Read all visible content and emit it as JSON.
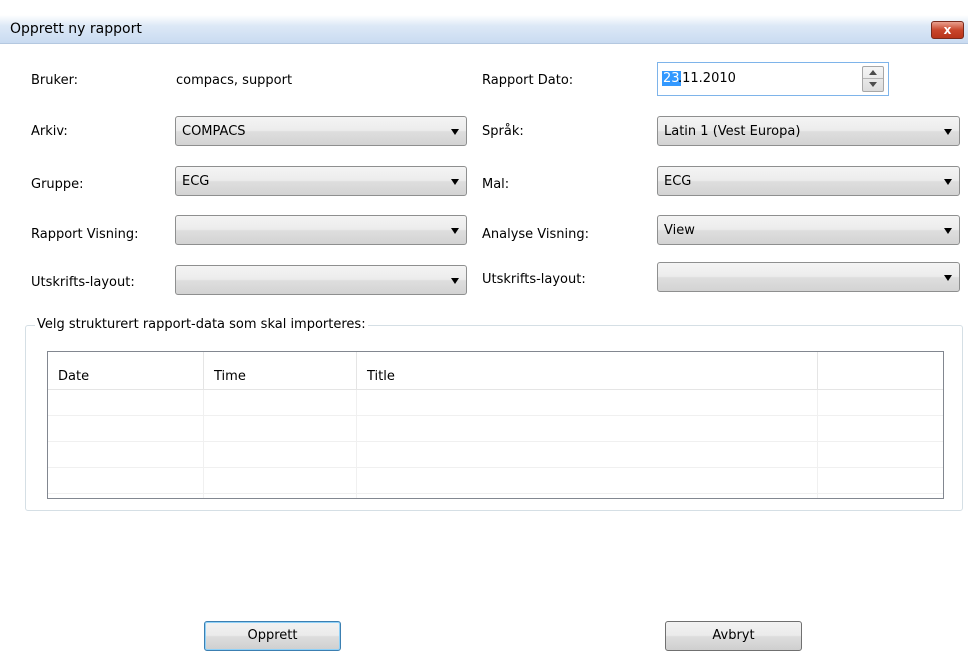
{
  "window": {
    "title": "Opprett ny rapport",
    "close_label": "x"
  },
  "left": {
    "user_label": "Bruker:",
    "user_value": "compacs, support",
    "archive_label": "Arkiv:",
    "archive_value": "COMPACS",
    "group_label": "Gruppe:",
    "group_value": "ECG",
    "report_view_label": "Rapport Visning:",
    "report_view_value": "",
    "print_layout_label": "Utskrifts-layout:",
    "print_layout_value": ""
  },
  "right": {
    "report_date_label": "Rapport Dato:",
    "report_date_day": "23",
    "report_date_rest": ".11.2010",
    "language_label": "Språk:",
    "language_value": "Latin 1 (Vest Europa)",
    "template_label": "Mal:",
    "template_value": "ECG",
    "analysis_view_label": "Analyse Visning:",
    "analysis_view_value": "View",
    "print_layout_label": "Utskrifts-layout:",
    "print_layout_value": ""
  },
  "import_group": {
    "legend": "Velg strukturert rapport-data som skal importeres:",
    "columns": [
      "Date",
      "Time",
      "Title",
      ""
    ],
    "rows": []
  },
  "buttons": {
    "create": "Opprett",
    "cancel": "Avbryt"
  }
}
